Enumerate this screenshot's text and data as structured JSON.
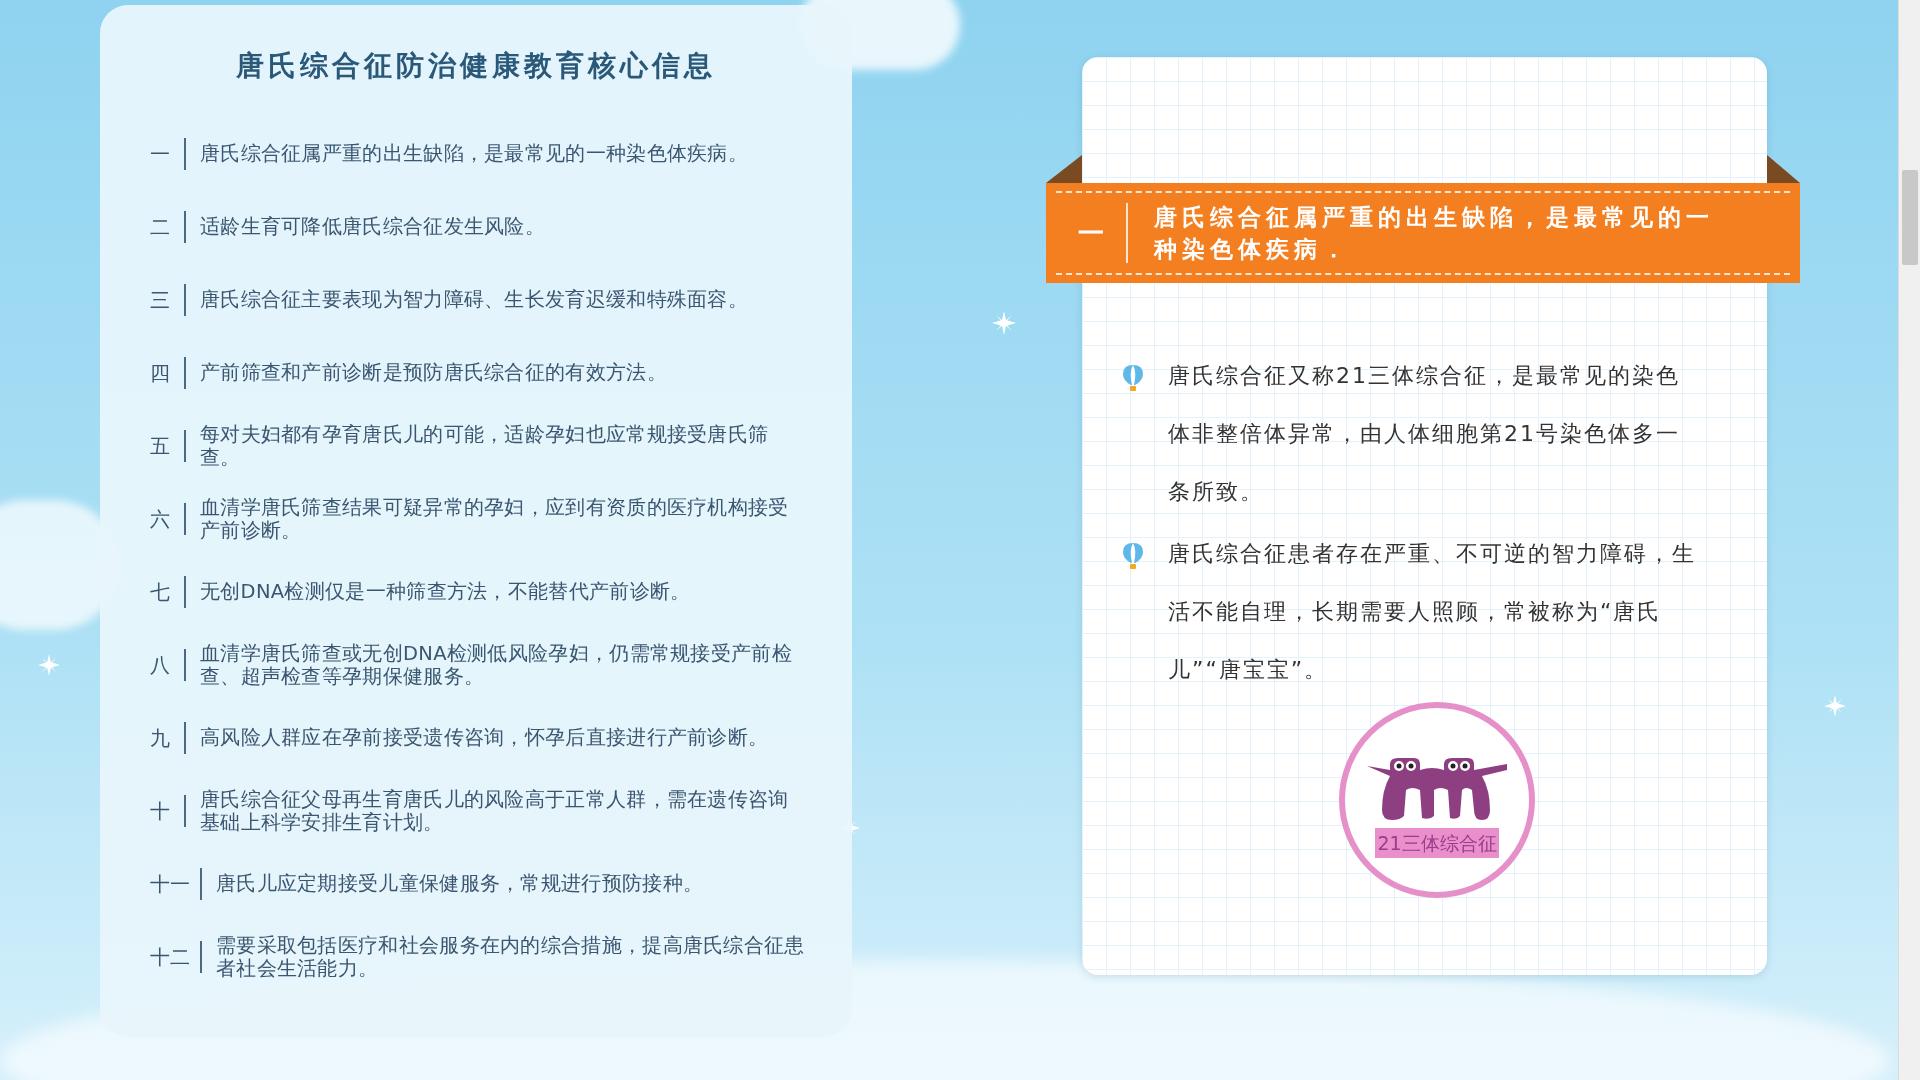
{
  "left_panel": {
    "title": "唐氏综合征防治健康教育核心信息",
    "items": [
      {
        "number": "一",
        "text": "唐氏综合征属严重的出生缺陷，是最常见的一种染色体疾病。"
      },
      {
        "number": "二",
        "text": "适龄生育可降低唐氏综合征发生风险。"
      },
      {
        "number": "三",
        "text": "唐氏综合征主要表现为智力障碍、生长发育迟缓和特殊面容。"
      },
      {
        "number": "四",
        "text": "产前筛查和产前诊断是预防唐氏综合征的有效方法。"
      },
      {
        "number": "五",
        "text": "每对夫妇都有孕育唐氏儿的可能，适龄孕妇也应常规接受唐氏筛查。"
      },
      {
        "number": "六",
        "text": "血清学唐氏筛查结果可疑异常的孕妇，应到有资质的医疗机构接受产前诊断。"
      },
      {
        "number": "七",
        "text": "无创DNA检测仅是一种筛查方法，不能替代产前诊断。"
      },
      {
        "number": "八",
        "text": "血清学唐氏筛查或无创DNA检测低风险孕妇，仍需常规接受产前检查、超声检查等孕期保健服务。"
      },
      {
        "number": "九",
        "text": "高风险人群应在孕前接受遗传咨询，怀孕后直接进行产前诊断。"
      },
      {
        "number": "十",
        "text": "唐氏综合征父母再生育唐氏儿的风险高于正常人群，需在遗传咨询基础上科学安排生育计划。"
      },
      {
        "number": "十一",
        "text": "唐氏儿应定期接受儿童保健服务，常规进行预防接种。"
      },
      {
        "number": "十二",
        "text": "需要采取包括医疗和社会服务在内的综合措施，提高唐氏综合征患者社会生活能力。"
      }
    ]
  },
  "right_card": {
    "banner": {
      "number": "一",
      "text": "唐氏综合征属严重的出生缺陷，是最常见的一种染色体疾病．"
    },
    "bullets": [
      "唐氏综合征又称21三体综合征，是最常见的染色体非整倍体异常，由人体细胞第21号染色体多一条所致。",
      "唐氏综合征患者存在严重、不可逆的智力障碍，生活不能自理，长期需要人照顾，常被称为“唐氏儿”“唐宝宝”。"
    ],
    "logo": {
      "label": "21三体综合征"
    }
  }
}
